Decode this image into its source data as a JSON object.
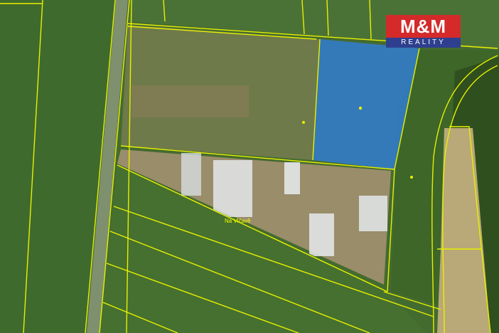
{
  "map": {
    "type": "cadastral aerial map",
    "street_label": "Na Vlčavě",
    "highlight_color": "#2f7fe0",
    "boundary_color": "#e8f000"
  },
  "branding": {
    "logo_main": "M&M",
    "logo_sub": "REALITY",
    "logo_primary_color": "#d42a2a",
    "logo_secondary_color": "#2f3f8f"
  }
}
